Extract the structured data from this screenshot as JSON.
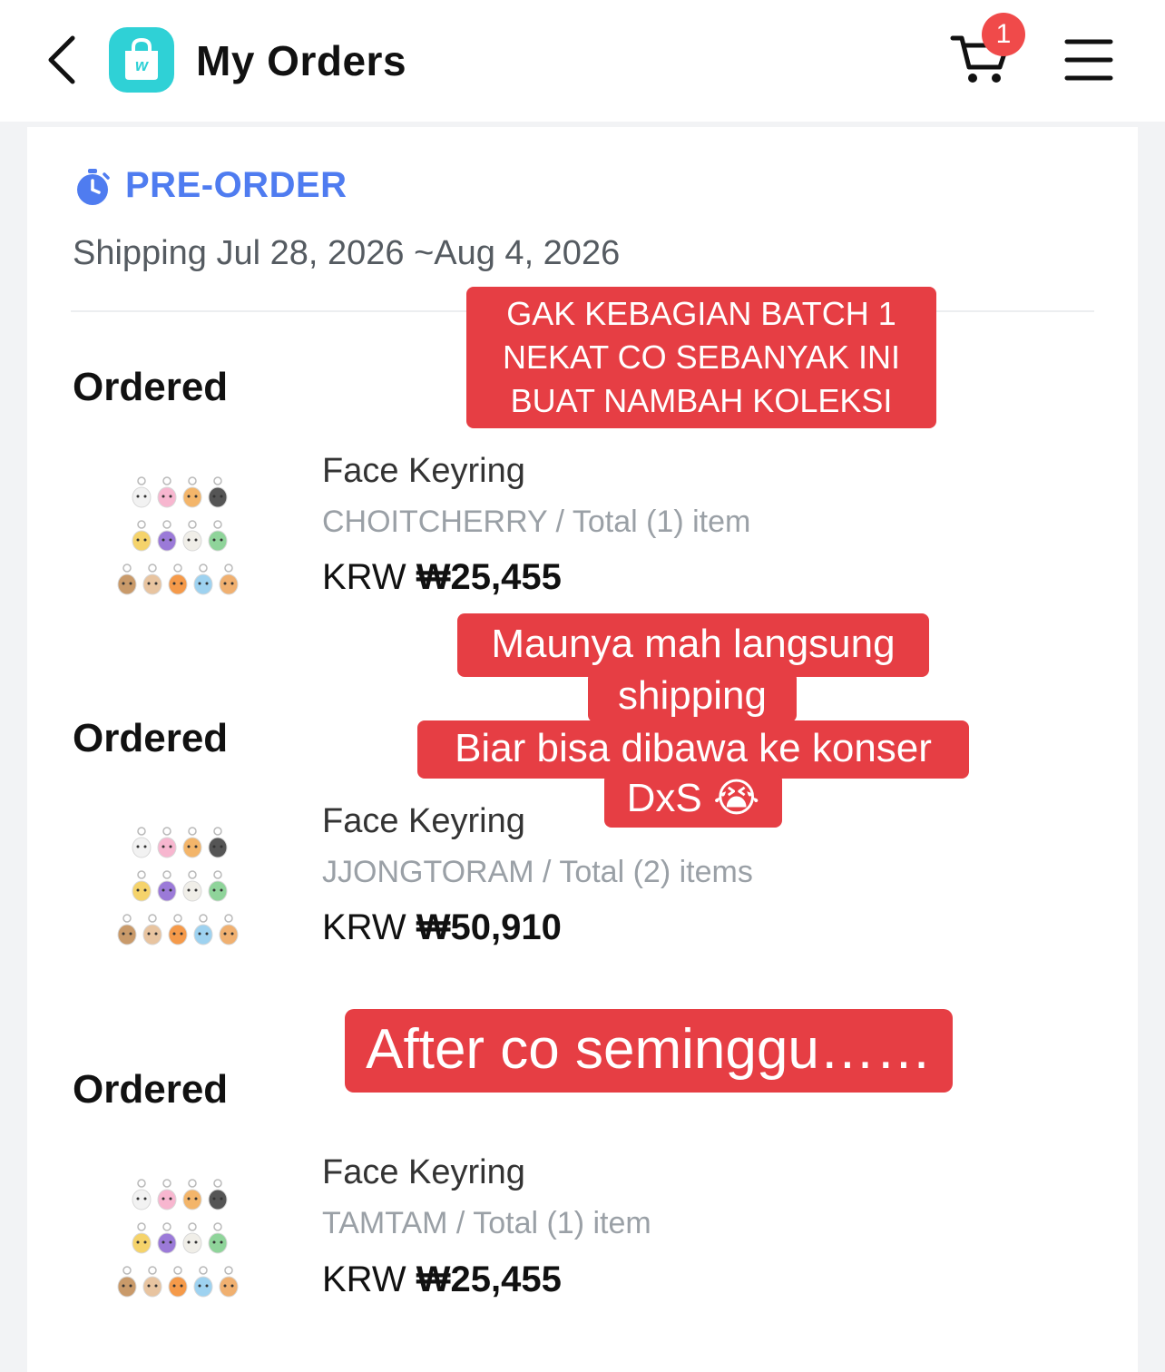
{
  "header": {
    "title": "My Orders",
    "cart_count": "1",
    "logo_letter": "w"
  },
  "preorder": {
    "label": "PRE-ORDER",
    "shipping": "Shipping Jul 28, 2026 ~Aug 4, 2026"
  },
  "orders": [
    {
      "status": "Ordered",
      "product": "Face Keyring",
      "meta": "CHOITCHERRY / Total (1) item",
      "currency": "KRW",
      "amount": "₩25,455"
    },
    {
      "status": "Ordered",
      "product": "Face Keyring",
      "meta": "JJONGTORAM / Total (2) items",
      "currency": "KRW",
      "amount": "₩50,910"
    },
    {
      "status": "Ordered",
      "product": "Face Keyring",
      "meta": "TAMTAM / Total (1) item",
      "currency": "KRW",
      "amount": "₩25,455"
    }
  ],
  "captions": {
    "c1": [
      "GAK KEBAGIAN BATCH 1",
      "NEKAT CO SEBANYAK INI",
      "BUAT NAMBAH KOLEKSI"
    ],
    "c2": [
      "Maunya mah langsung",
      "shipping",
      "Biar bisa dibawa ke konser",
      "DxS 😭"
    ],
    "c3": "After co seminggu……"
  },
  "colors": {
    "accent": "#4f7cf0",
    "caption_bg": "#e63e44",
    "badge": "#f04a4a",
    "logo": "#2fd1d6"
  }
}
